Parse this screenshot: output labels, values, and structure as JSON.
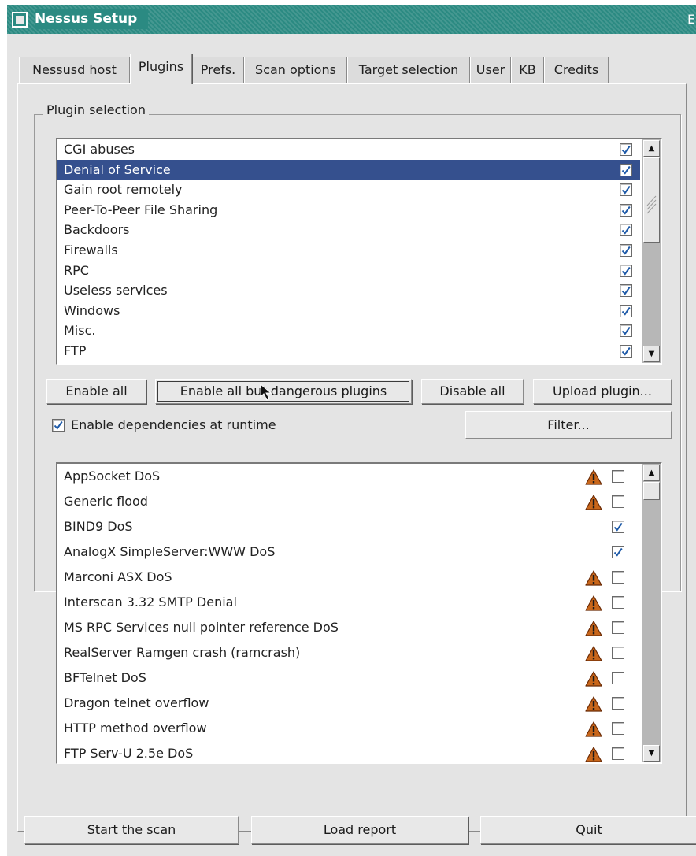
{
  "window": {
    "title": "Nessus Setup",
    "corner_glyph": "E"
  },
  "tabs": [
    {
      "label": "Nessusd host"
    },
    {
      "label": "Plugins",
      "active": true
    },
    {
      "label": "Prefs."
    },
    {
      "label": "Scan options"
    },
    {
      "label": "Target selection"
    },
    {
      "label": "User"
    },
    {
      "label": "KB"
    },
    {
      "label": "Credits"
    }
  ],
  "plugin_selection": {
    "frame_label": "Plugin selection",
    "categories": [
      {
        "label": "CGI abuses",
        "checked": true,
        "selected": false
      },
      {
        "label": "Denial of Service",
        "checked": true,
        "selected": true
      },
      {
        "label": "Gain root remotely",
        "checked": true,
        "selected": false
      },
      {
        "label": "Peer-To-Peer File Sharing",
        "checked": true,
        "selected": false
      },
      {
        "label": "Backdoors",
        "checked": true,
        "selected": false
      },
      {
        "label": "Firewalls",
        "checked": true,
        "selected": false
      },
      {
        "label": "RPC",
        "checked": true,
        "selected": false
      },
      {
        "label": "Useless services",
        "checked": true,
        "selected": false
      },
      {
        "label": "Windows",
        "checked": true,
        "selected": false
      },
      {
        "label": "Misc.",
        "checked": true,
        "selected": false
      },
      {
        "label": "FTP",
        "checked": true,
        "selected": false
      }
    ],
    "buttons": {
      "enable_all": "Enable all",
      "enable_safe": "Enable all but dangerous plugins",
      "disable_all": "Disable all",
      "upload": "Upload plugin...",
      "filter": "Filter..."
    },
    "dependencies": {
      "label": "Enable dependencies at runtime",
      "checked": true
    },
    "plugins": [
      {
        "label": "AppSocket DoS",
        "dangerous": true,
        "checked": false
      },
      {
        "label": "Generic flood",
        "dangerous": true,
        "checked": false
      },
      {
        "label": "BIND9 DoS",
        "dangerous": false,
        "checked": true
      },
      {
        "label": "AnalogX SimpleServer:WWW  DoS",
        "dangerous": false,
        "checked": true
      },
      {
        "label": "Marconi ASX DoS",
        "dangerous": true,
        "checked": false
      },
      {
        "label": "Interscan 3.32 SMTP Denial",
        "dangerous": true,
        "checked": false
      },
      {
        "label": "MS RPC Services null pointer reference DoS",
        "dangerous": true,
        "checked": false
      },
      {
        "label": "RealServer Ramgen crash (ramcrash)",
        "dangerous": true,
        "checked": false
      },
      {
        "label": "BFTelnet DoS",
        "dangerous": true,
        "checked": false
      },
      {
        "label": "Dragon telnet overflow",
        "dangerous": true,
        "checked": false
      },
      {
        "label": "HTTP method overflow",
        "dangerous": true,
        "checked": false
      },
      {
        "label": "FTP Serv-U 2.5e DoS",
        "dangerous": true,
        "checked": false
      }
    ]
  },
  "footer": {
    "start": "Start the scan",
    "load": "Load report",
    "quit": "Quit"
  },
  "colors": {
    "titlebar": "#2b8a82",
    "selection": "#35508e",
    "check": "#1e5aa8",
    "warning": "#c8661a"
  }
}
